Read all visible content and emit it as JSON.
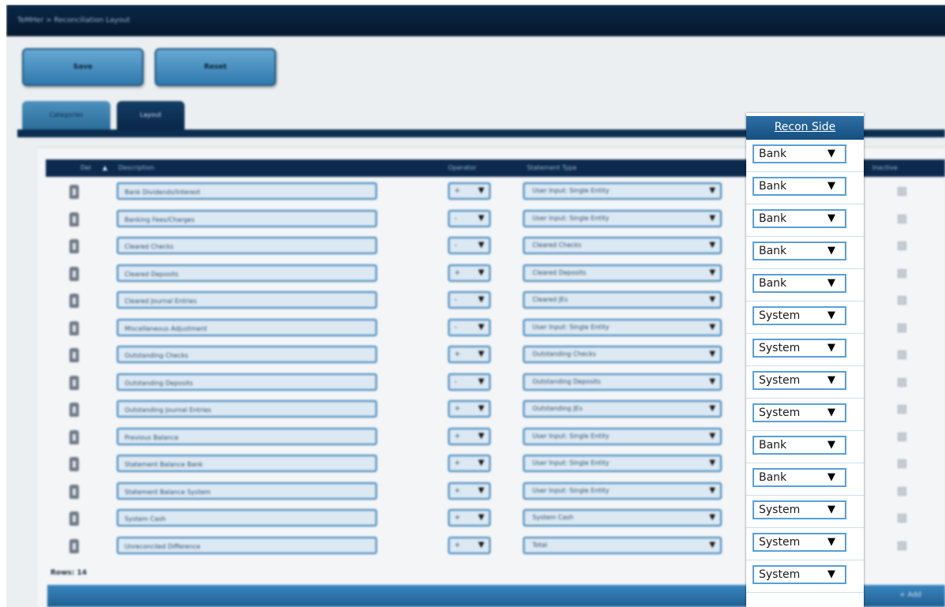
{
  "window": {
    "title": "TeMHer > Reconciliation Layout"
  },
  "toolbar": {
    "save_label": "Save",
    "reset_label": "Reset"
  },
  "tabs": [
    {
      "label": "Categories"
    },
    {
      "label": "Layout"
    }
  ],
  "grid": {
    "columns": {
      "del": "Del",
      "description": "Description",
      "operator": "Operator",
      "statement_type": "Statement Type",
      "inactive": "Inactive"
    },
    "rows": [
      {
        "description": "Bank Dividends/Interest",
        "operator": "+",
        "statement_type": "User Input: Single Entity",
        "recon_side": "Bank"
      },
      {
        "description": "Banking Fees/Charges",
        "operator": "-",
        "statement_type": "User Input: Single Entity",
        "recon_side": "Bank"
      },
      {
        "description": "Cleared Checks",
        "operator": "-",
        "statement_type": "Cleared Checks",
        "recon_side": "Bank"
      },
      {
        "description": "Cleared Deposits",
        "operator": "+",
        "statement_type": "Cleared Deposits",
        "recon_side": "Bank"
      },
      {
        "description": "Cleared Journal Entries",
        "operator": "-",
        "statement_type": "Cleared JEs",
        "recon_side": "Bank"
      },
      {
        "description": "Miscellaneous Adjustment",
        "operator": "-",
        "statement_type": "User Input: Single Entity",
        "recon_side": "System"
      },
      {
        "description": "Outstanding Checks",
        "operator": "+",
        "statement_type": "Outstanding Checks",
        "recon_side": "System"
      },
      {
        "description": "Outstanding Deposits",
        "operator": "-",
        "statement_type": "Outstanding Deposits",
        "recon_side": "System"
      },
      {
        "description": "Outstanding Journal Entries",
        "operator": "+",
        "statement_type": "Outstanding JEs",
        "recon_side": "System"
      },
      {
        "description": "Previous Balance",
        "operator": "+",
        "statement_type": "User Input: Single Entity",
        "recon_side": "Bank"
      },
      {
        "description": "Statement Balance Bank",
        "operator": "+",
        "statement_type": "User Input: Single Entity",
        "recon_side": "Bank"
      },
      {
        "description": "Statement Balance System",
        "operator": "+",
        "statement_type": "User Input: Single Entity",
        "recon_side": "System"
      },
      {
        "description": "System Cash",
        "operator": "+",
        "statement_type": "System Cash",
        "recon_side": "System"
      },
      {
        "description": "Unreconciled Difference",
        "operator": "+",
        "statement_type": "Total",
        "recon_side": "System"
      }
    ],
    "rows_count": "Rows: 14",
    "add_label": "+ Add"
  },
  "recon_side": {
    "header": "Recon Side",
    "values": [
      "Bank",
      "Bank",
      "Bank",
      "Bank",
      "Bank",
      "System",
      "System",
      "System",
      "System",
      "Bank",
      "Bank",
      "System",
      "System",
      "System"
    ]
  },
  "icons": {
    "delete": "trash-icon",
    "dropdown": "dropdown-arrow-icon",
    "inactive": "checkbox-icon"
  }
}
